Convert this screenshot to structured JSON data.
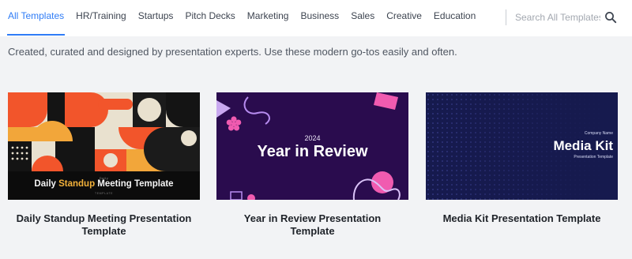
{
  "nav": {
    "tabs": [
      {
        "label": "All Templates",
        "active": true
      },
      {
        "label": "HR/Training"
      },
      {
        "label": "Startups"
      },
      {
        "label": "Pitch Decks"
      },
      {
        "label": "Marketing"
      },
      {
        "label": "Business"
      },
      {
        "label": "Sales"
      },
      {
        "label": "Creative"
      },
      {
        "label": "Education"
      }
    ],
    "accent": "#2f7cf6"
  },
  "search": {
    "placeholder": "Search All Templates",
    "value": "",
    "icon": "search-icon"
  },
  "tagline": "Created, curated and designed by presentation experts. Use these modern go-tos easily and often.",
  "templates": [
    {
      "title": "Daily Standup Meeting Presentation Template",
      "thumb": {
        "kicker": "Daily",
        "title_plain_start": "Daily ",
        "title_highlight": "Standup",
        "title_plain_end": " Meeting Template",
        "sub": "TEMPLATE",
        "colors": {
          "bg": "#0c0c0c",
          "orange": "#f2552b",
          "gold": "#f2a63a",
          "cream": "#e9e1cf"
        }
      }
    },
    {
      "title": "Year in Review Presentation Template",
      "thumb": {
        "year": "2024",
        "title": "Year in Review",
        "colors": {
          "bg": "#2a0c4e",
          "pink": "#f05bb0",
          "light": "#c9a9f0"
        }
      }
    },
    {
      "title": "Media Kit Presentation Template",
      "thumb": {
        "company": "Company Name",
        "title": "Media Kit",
        "sub": "Presentation Template",
        "colors": {
          "bg": "#161a4e",
          "dots": "#3a4090"
        }
      }
    }
  ]
}
